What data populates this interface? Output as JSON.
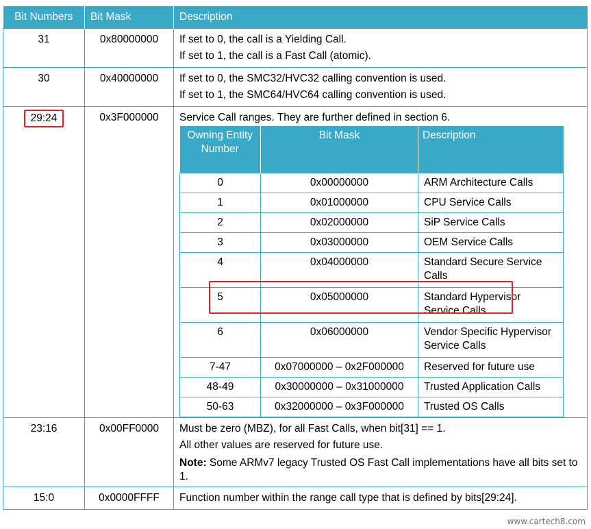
{
  "headers": [
    "Bit Numbers",
    "Bit Mask",
    "Description"
  ],
  "rows": [
    {
      "bits": "31",
      "mask": "0x80000000",
      "desc": [
        "If set to 0, the call is a Yielding Call.",
        "If set to 1, the call is a Fast Call (atomic)."
      ]
    },
    {
      "bits": "30",
      "mask": "0x40000000",
      "desc": [
        "If set to 0, the SMC32/HVC32 calling convention is used.",
        "If set to 1, the SMC64/HVC64 calling convention is used."
      ]
    },
    {
      "bits": "29:24",
      "mask": "0x3F000000",
      "desc": [
        "Service Call ranges. They are further defined in section 6."
      ]
    },
    {
      "bits": "23:16",
      "mask": "0x00FF0000",
      "desc": [
        "Must be zero (MBZ), for all Fast Calls, when bit[31] == 1.",
        "All other values are reserved for future use."
      ],
      "note_label": "Note:",
      "note_text": " Some ARMv7 legacy Trusted OS Fast Call implementations have all bits set to 1."
    },
    {
      "bits": "15:0",
      "mask": "0x0000FFFF",
      "desc": [
        "Function number within the range call type that is defined by bits[29:24]."
      ]
    }
  ],
  "inner": {
    "headers": [
      "Owning Entity Number",
      "Bit Mask",
      "Description"
    ],
    "rows": [
      {
        "num": "0",
        "mask": "0x00000000",
        "desc": "ARM Architecture Calls"
      },
      {
        "num": "1",
        "mask": "0x01000000",
        "desc": "CPU Service Calls"
      },
      {
        "num": "2",
        "mask": "0x02000000",
        "desc": "SiP Service Calls"
      },
      {
        "num": "3",
        "mask": "0x03000000",
        "desc": "OEM Service Calls"
      },
      {
        "num": "4",
        "mask": "0x04000000",
        "desc": "Standard Secure Service Calls"
      },
      {
        "num": "5",
        "mask": "0x05000000",
        "desc": "Standard Hypervisor Service Calls"
      },
      {
        "num": "6",
        "mask": "0x06000000",
        "desc": "Vendor Specific Hypervisor Service Calls"
      },
      {
        "num": "7-47",
        "mask": "0x07000000 – 0x2F000000",
        "desc": "Reserved for future use"
      },
      {
        "num": "48-49",
        "mask": "0x30000000 – 0x31000000",
        "desc": "Trusted Application Calls"
      },
      {
        "num": "50-63",
        "mask": "0x32000000 – 0x3F000000",
        "desc": "Trusted OS Calls"
      }
    ]
  },
  "watermark": "www.cartech8.com"
}
